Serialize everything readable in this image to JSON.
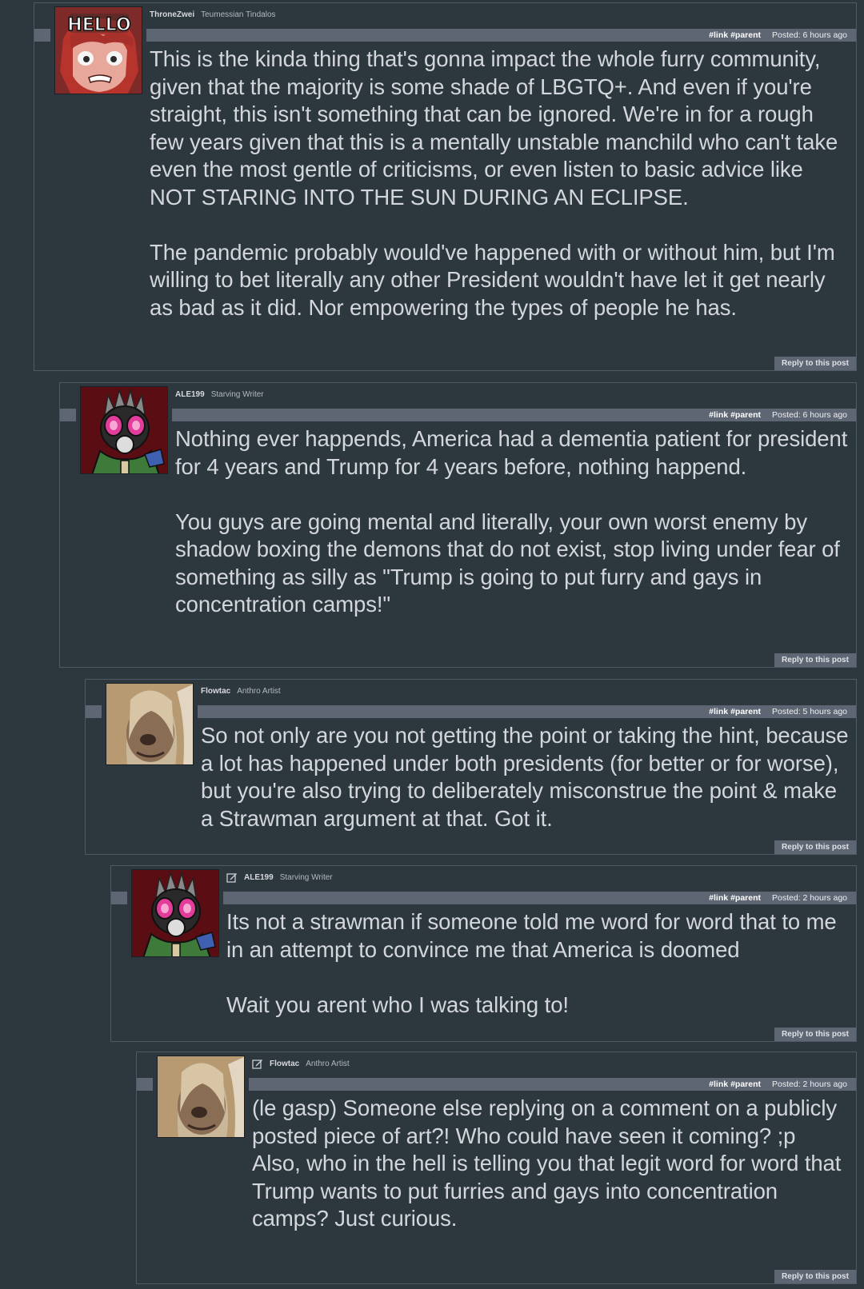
{
  "comments": [
    {
      "username": "ThroneZwei",
      "title": "Teumessian Tindalos",
      "edited": false,
      "link": "#link",
      "parent": "#parent",
      "posted": "Posted: 6 hours ago",
      "paragraphs": [
        "This is the kinda thing that's gonna impact the whole furry community, given that the majority is some shade of LBGTQ+. And even if you're straight, this isn't something that can be ignored. We're in for a rough few years given that this is a mentally unstable manchild who can't take even the most gentle of criticisms, or even listen to basic advice like NOT STARING INTO THE SUN DURING AN ECLIPSE.",
        "The pandemic probably would've happened with or without him, but I'm willing to bet literally any other President wouldn't have let it get nearly as bad as it did. Nor empowering the types of people he has."
      ],
      "reply": "Reply to this post",
      "avatar_text": "HELLO"
    },
    {
      "username": "ALE199",
      "title": "Starving Writer",
      "edited": false,
      "link": "#link",
      "parent": "#parent",
      "posted": "Posted: 6 hours ago",
      "paragraphs": [
        "Nothing ever happends, America had a dementia patient for president for 4 years and Trump for 4 years before, nothing happend.",
        "You guys are going mental and literally, your own worst enemy by shadow boxing the demons that do not exist, stop living under fear of something as silly as \"Trump is going to put furry and gays in concentration camps!\""
      ],
      "reply": "Reply to this post"
    },
    {
      "username": "Flowtac",
      "title": "Anthro Artist",
      "edited": false,
      "link": "#link",
      "parent": "#parent",
      "posted": "Posted: 5 hours ago",
      "paragraphs": [
        "So not only are you not getting the point or taking the hint, because a lot has happened under both presidents (for better or for worse), but you're also trying to deliberately misconstrue the point & make a Strawman argument at that. Got it."
      ],
      "reply": "Reply to this post"
    },
    {
      "username": "ALE199",
      "title": "Starving Writer",
      "edited": true,
      "link": "#link",
      "parent": "#parent",
      "posted": "Posted: 2 hours ago",
      "paragraphs": [
        "Its not a strawman if someone told me word for word that to me in an attempt to convince me that America is doomed",
        "Wait you arent who I was talking to!"
      ],
      "reply": "Reply to this post"
    },
    {
      "username": "Flowtac",
      "title": "Anthro Artist",
      "edited": true,
      "link": "#link",
      "parent": "#parent",
      "posted": "Posted: 2 hours ago",
      "paragraphs": [
        "(le gasp) Someone else replying on a comment on a publicly posted piece of art?! Who could have seen it coming? ;p",
        "Also, who in the hell is telling you that legit word for word that Trump wants to put furries and gays into concentration camps? Just curious."
      ],
      "reply": "Reply to this post"
    }
  ],
  "colors": {
    "background": "#2d373e",
    "border": "#4f5b64",
    "bar": "#5e6674",
    "text": "#d3d7db"
  }
}
